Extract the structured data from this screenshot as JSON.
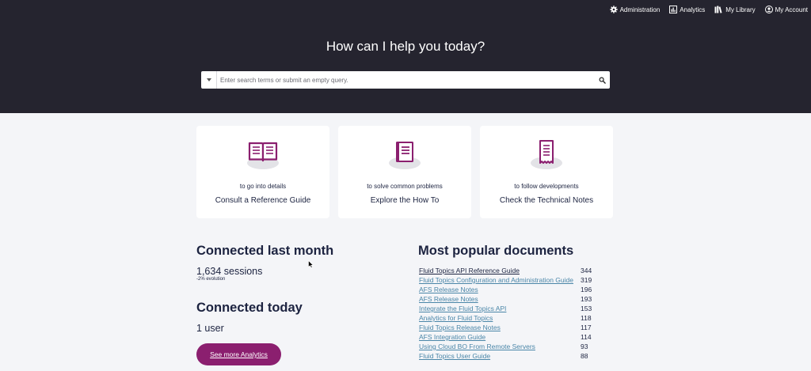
{
  "nav": {
    "items": [
      {
        "label": "Administration",
        "icon": "gear-icon"
      },
      {
        "label": "Analytics",
        "icon": "bar-chart-icon"
      },
      {
        "label": "My Library",
        "icon": "library-icon"
      },
      {
        "label": "My Account",
        "icon": "user-circle-icon"
      }
    ]
  },
  "hero": {
    "title": "How can I help you today?"
  },
  "search": {
    "placeholder": "Enter search terms or submit an empty query.",
    "value": ""
  },
  "cards": [
    {
      "subtitle": "to go into details",
      "title": "Consult a Reference Guide",
      "icon": "open-book-icon"
    },
    {
      "subtitle": "to solve common problems",
      "title": "Explore the How To",
      "icon": "notebook-icon"
    },
    {
      "subtitle": "to follow developments",
      "title": "Check the Technical Notes",
      "icon": "receipt-icon"
    }
  ],
  "stats": {
    "connected_month_title": "Connected last month",
    "sessions": "1,634 sessions",
    "evolution": "-2% evolution",
    "connected_today_title": "Connected today",
    "users": "1 user",
    "more_button": "See more Analytics"
  },
  "popular": {
    "title": "Most popular documents",
    "documents": [
      {
        "name": "Fluid Topics API Reference Guide",
        "count": "344"
      },
      {
        "name": "Fluid Topics Configuration and Administration Guide",
        "count": "319"
      },
      {
        "name": "AFS Release Notes",
        "count": "196"
      },
      {
        "name": "AFS Release Notes",
        "count": "193"
      },
      {
        "name": "Integrate the Fluid Topics API",
        "count": "153"
      },
      {
        "name": "Analytics for Fluid Topics",
        "count": "118"
      },
      {
        "name": "Fluid Topics Release Notes",
        "count": "117"
      },
      {
        "name": "AFS Integration Guide",
        "count": "114"
      },
      {
        "name": "Using Cloud BO From Remote Servers",
        "count": "93"
      },
      {
        "name": "Fluid Topics User Guide",
        "count": "88"
      }
    ]
  },
  "colors": {
    "header_bg": "#25242f",
    "page_bg": "#f4f5f8",
    "accent": "#8b1f6f",
    "link": "#4a86a8",
    "text": "#1c2340"
  }
}
